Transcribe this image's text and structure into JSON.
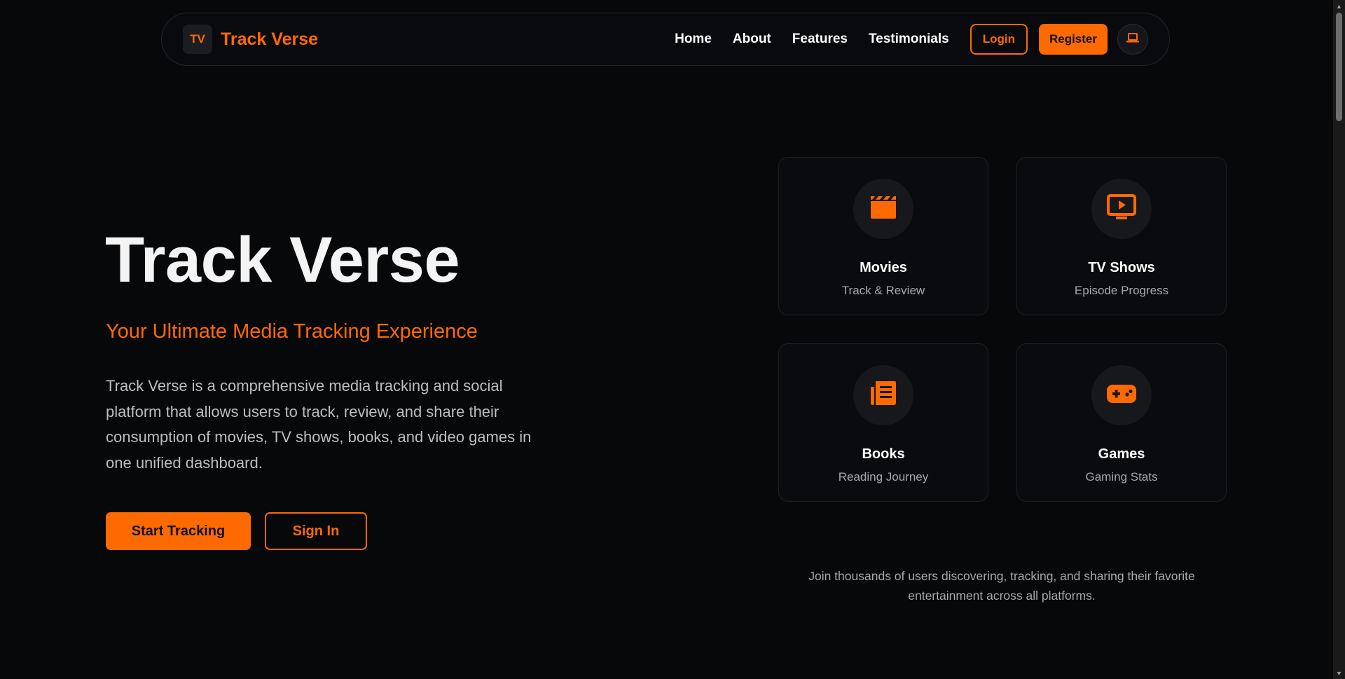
{
  "brand": {
    "badge": "TV",
    "name": "Track Verse"
  },
  "nav": {
    "links": [
      "Home",
      "About",
      "Features",
      "Testimonials"
    ],
    "login_label": "Login",
    "register_label": "Register",
    "theme_icon": "laptop-icon"
  },
  "hero": {
    "title": "Track Verse",
    "subtitle": "Your Ultimate Media Tracking Experience",
    "description": "Track Verse is a comprehensive media tracking and social platform that allows users to track, review, and share their consumption of movies, TV shows, books, and video games in one unified dashboard.",
    "start_label": "Start Tracking",
    "signin_label": "Sign In"
  },
  "cards": [
    {
      "title": "Movies",
      "subtitle": "Track & Review",
      "icon": "clapperboard-icon"
    },
    {
      "title": "TV Shows",
      "subtitle": "Episode Progress",
      "icon": "tv-play-icon"
    },
    {
      "title": "Books",
      "subtitle": "Reading Journey",
      "icon": "book-icon"
    },
    {
      "title": "Games",
      "subtitle": "Gaming Stats",
      "icon": "gamepad-icon"
    }
  ],
  "join_text": "Join thousands of users discovering, tracking, and sharing their favorite entertainment across all platforms.",
  "colors": {
    "accent": "#ff6a00",
    "background": "#07080a",
    "card_bg": "#0a0b0e"
  }
}
